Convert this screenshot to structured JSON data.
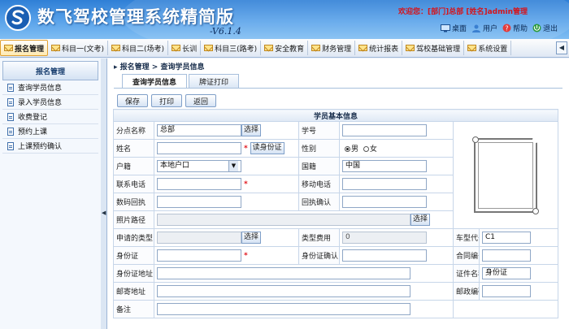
{
  "header": {
    "title": "数飞驾校管理系统精简版",
    "version": "-V6.1.4",
    "user_info": "欢迎您：[部门]总部 [姓名]admin管理",
    "actions": [
      {
        "label": "桌面",
        "icon": "desktop-icon"
      },
      {
        "label": "用户",
        "icon": "user-icon"
      },
      {
        "label": "帮助",
        "icon": "help-icon"
      },
      {
        "label": "退出",
        "icon": "exit-icon"
      }
    ]
  },
  "menubar": {
    "items": [
      "报名管理",
      "科目一(文考)",
      "科目二(场考)",
      "长训",
      "科目三(路考)",
      "安全教育",
      "财务管理",
      "统计报表",
      "驾校基础管理",
      "系统设置"
    ],
    "active_index": 0
  },
  "sidebar": {
    "title": "报名管理",
    "items": [
      "查询学员信息",
      "录入学员信息",
      "收费登记",
      "预约上课",
      "上课预约确认"
    ]
  },
  "main": {
    "breadcrumb": "报名管理 > 查询学员信息",
    "tabs": [
      "查询学员信息",
      "牌证打印"
    ],
    "toolbar": {
      "save": "保存",
      "print": "打印",
      "back": "返回"
    },
    "section_title": "学员基本信息",
    "form": {
      "branch_label": "分点名称",
      "branch_value": "总部",
      "select_label": "选择",
      "student_no_label": "学号",
      "name_label": "姓名",
      "read_id_label": "读身份证",
      "gender_label": "性别",
      "gender_male": "男",
      "gender_female": "女",
      "hukou_label": "户籍",
      "hukou_value": "本地户口",
      "nationality_label": "国籍",
      "nationality_value": "中国",
      "phone_label": "联系电话",
      "mobile_label": "移动电话",
      "receipt_label": "数码回执",
      "receipt_confirm_label": "回执确认",
      "photo_path_label": "照片路径",
      "apply_type_label": "申请的类型",
      "type_fee_label": "类型费用",
      "type_fee_value": "0",
      "car_code_label": "车型代号",
      "car_code_value": "C1",
      "id_label": "身份证",
      "id_confirm_label": "身份证确认",
      "contract_label": "合同编号",
      "id_address_label": "身份证地址",
      "cert_name_label": "证件名称",
      "cert_name_value": "身份证",
      "mail_address_label": "邮寄地址",
      "postcode_label": "邮政编码",
      "remark_label": "备注"
    }
  },
  "colors": {
    "header": "#3a86db",
    "required": "#e0141c",
    "user_info": "#d4141c"
  }
}
